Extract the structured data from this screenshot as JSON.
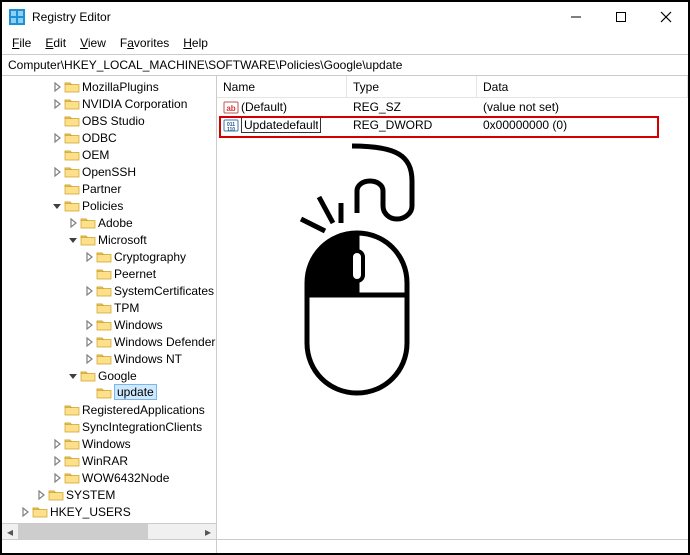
{
  "window": {
    "title": "Registry Editor"
  },
  "menubar": {
    "file": "File",
    "edit": "Edit",
    "view": "View",
    "favorites": "Favorites",
    "help": "Help"
  },
  "address": {
    "value": "Computer\\HKEY_LOCAL_MACHINE\\SOFTWARE\\Policies\\Google\\update"
  },
  "tree": {
    "items": [
      {
        "ind": 3,
        "tw": ">",
        "label": "MozillaPlugins"
      },
      {
        "ind": 3,
        "tw": ">",
        "label": "NVIDIA Corporation"
      },
      {
        "ind": 3,
        "tw": "",
        "label": "OBS Studio"
      },
      {
        "ind": 3,
        "tw": ">",
        "label": "ODBC"
      },
      {
        "ind": 3,
        "tw": "",
        "label": "OEM"
      },
      {
        "ind": 3,
        "tw": ">",
        "label": "OpenSSH"
      },
      {
        "ind": 3,
        "tw": "",
        "label": "Partner"
      },
      {
        "ind": 3,
        "tw": "v",
        "label": "Policies"
      },
      {
        "ind": 4,
        "tw": ">",
        "label": "Adobe"
      },
      {
        "ind": 4,
        "tw": "v",
        "label": "Microsoft"
      },
      {
        "ind": 5,
        "tw": ">",
        "label": "Cryptography"
      },
      {
        "ind": 5,
        "tw": "",
        "label": "Peernet"
      },
      {
        "ind": 5,
        "tw": ">",
        "label": "SystemCertificates"
      },
      {
        "ind": 5,
        "tw": "",
        "label": "TPM"
      },
      {
        "ind": 5,
        "tw": ">",
        "label": "Windows"
      },
      {
        "ind": 5,
        "tw": ">",
        "label": "Windows Defender"
      },
      {
        "ind": 5,
        "tw": ">",
        "label": "Windows NT"
      },
      {
        "ind": 4,
        "tw": "v",
        "label": "Google"
      },
      {
        "ind": 5,
        "tw": "",
        "label": "update",
        "selected": true
      },
      {
        "ind": 3,
        "tw": "",
        "label": "RegisteredApplications"
      },
      {
        "ind": 3,
        "tw": "",
        "label": "SyncIntegrationClients"
      },
      {
        "ind": 3,
        "tw": ">",
        "label": "Windows"
      },
      {
        "ind": 3,
        "tw": ">",
        "label": "WinRAR"
      },
      {
        "ind": 3,
        "tw": ">",
        "label": "WOW6432Node"
      },
      {
        "ind": 2,
        "tw": ">",
        "label": "SYSTEM"
      },
      {
        "ind": 1,
        "tw": ">",
        "label": "HKEY_USERS"
      }
    ]
  },
  "list": {
    "columns": {
      "name": "Name",
      "type": "Type",
      "data": "Data"
    },
    "rows": [
      {
        "icon": "string",
        "name": "(Default)",
        "type": "REG_SZ",
        "data": "(value not set)"
      },
      {
        "icon": "dword",
        "editing": true,
        "name": "Updatedefault",
        "type": "REG_DWORD",
        "data": "0x00000000 (0)"
      }
    ]
  }
}
